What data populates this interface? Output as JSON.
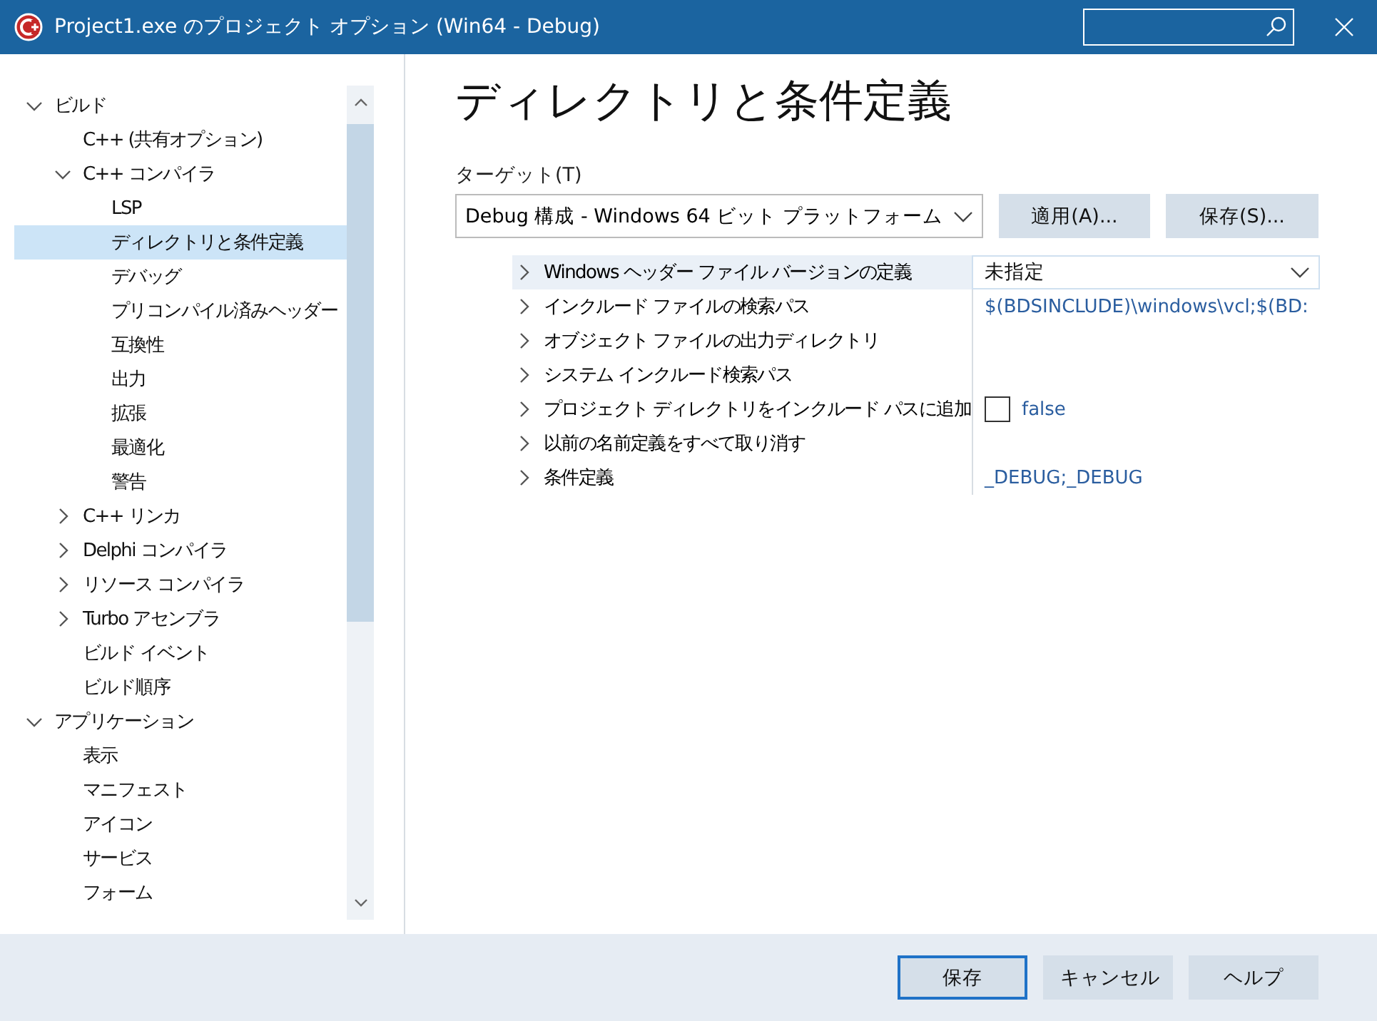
{
  "window": {
    "title": "Project1.exe のプロジェクト オプション  (Win64 - Debug)"
  },
  "tree": [
    {
      "label": "ビルド",
      "expanded": true,
      "selected": false,
      "children": [
        {
          "label": "C++ (共有オプション)",
          "selected": false
        },
        {
          "label": "C++ コンパイラ",
          "expanded": true,
          "selected": false,
          "children": [
            {
              "label": "LSP",
              "selected": false
            },
            {
              "label": "ディレクトリと条件定義",
              "selected": true
            },
            {
              "label": "デバッグ",
              "selected": false
            },
            {
              "label": "プリコンパイル済みヘッダー",
              "selected": false
            },
            {
              "label": "互換性",
              "selected": false
            },
            {
              "label": "出力",
              "selected": false
            },
            {
              "label": "拡張",
              "selected": false
            },
            {
              "label": "最適化",
              "selected": false
            },
            {
              "label": "警告",
              "selected": false
            }
          ]
        },
        {
          "label": "C++ リンカ",
          "expanded": false,
          "selected": false
        },
        {
          "label": "Delphi コンパイラ",
          "expanded": false,
          "selected": false
        },
        {
          "label": "リソース コンパイラ",
          "expanded": false,
          "selected": false
        },
        {
          "label": "Turbo アセンブラ",
          "expanded": false,
          "selected": false
        },
        {
          "label": "ビルド イベント",
          "selected": false
        },
        {
          "label": "ビルド順序",
          "selected": false
        }
      ]
    },
    {
      "label": "アプリケーション",
      "expanded": true,
      "selected": false,
      "children": [
        {
          "label": "表示",
          "selected": false
        },
        {
          "label": "マニフェスト",
          "selected": false
        },
        {
          "label": "アイコン",
          "selected": false
        },
        {
          "label": "サービス",
          "selected": false
        },
        {
          "label": "フォーム",
          "selected": false
        }
      ]
    }
  ],
  "heading": "ディレクトリと条件定義",
  "target": {
    "label": "ターゲット(T)",
    "value": "Debug 構成 - Windows 64 ビット プラットフォーム",
    "buttons": [
      "適用(A)...",
      "保存(S)..."
    ]
  },
  "properties": [
    {
      "name": "Windows ヘッダー ファイル バージョンの定義",
      "selected": true,
      "kind": "dropdown",
      "value": "未指定"
    },
    {
      "name": "インクルード ファイルの検索パス",
      "selected": false,
      "kind": "text",
      "value": "$(BDSINCLUDE)\\windows\\vcl;$(BD:"
    },
    {
      "name": "オブジェクト ファイルの出力ディレクトリ",
      "selected": false,
      "kind": "empty"
    },
    {
      "name": "システム インクルード検索パス",
      "selected": false,
      "kind": "empty"
    },
    {
      "name": "プロジェクト ディレクトリをインクルード パスに追加",
      "selected": false,
      "kind": "checkbox",
      "checked": false,
      "value": "false"
    },
    {
      "name": "以前の名前定義をすべて取り消す",
      "selected": false,
      "kind": "empty"
    },
    {
      "name": "条件定義",
      "selected": false,
      "kind": "text",
      "value": "_DEBUG;_DEBUG"
    }
  ],
  "footer_buttons": [
    {
      "label": "保存",
      "selected": true
    },
    {
      "label": "キャンセル",
      "selected": false
    },
    {
      "label": "ヘルプ",
      "selected": false
    }
  ]
}
